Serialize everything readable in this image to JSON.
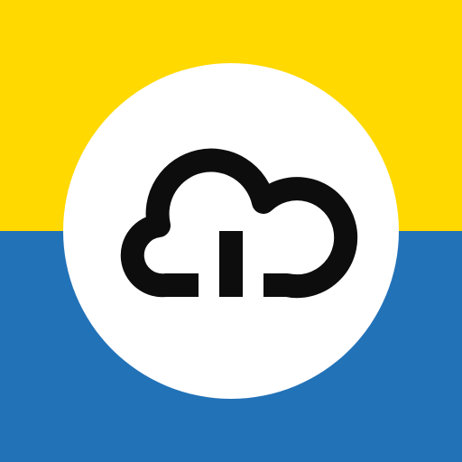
{
  "icon": {
    "name": "cloud-upload-icon",
    "colors": {
      "top_band": "#FFD900",
      "bottom_band": "#2272B8",
      "disc": "#FFFFFF",
      "glyph": "#0D0D0D"
    }
  }
}
